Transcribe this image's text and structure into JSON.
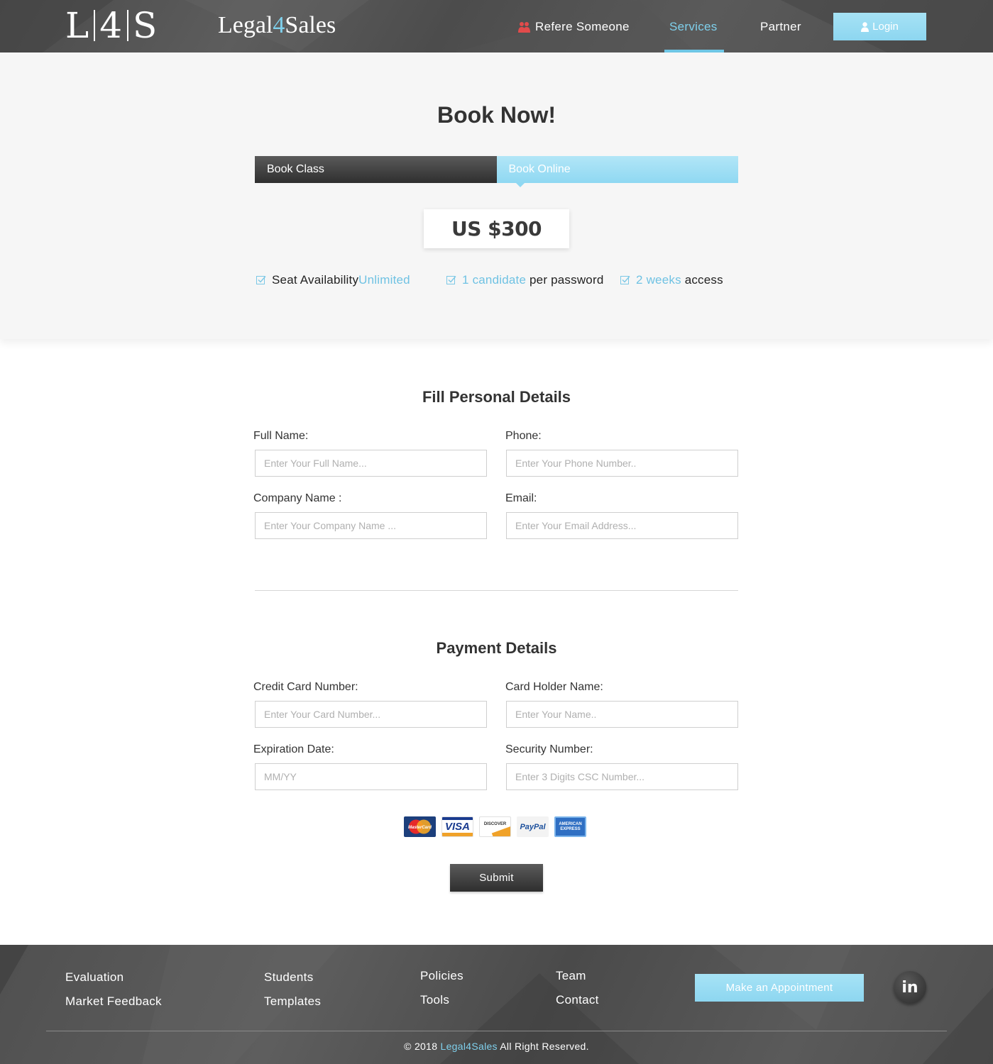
{
  "header": {
    "logo_mark": [
      "L",
      "4",
      "S"
    ],
    "brand_name_pre": "Legal",
    "brand_name_num": "4",
    "brand_name_post": "Sales",
    "nav": {
      "refer": "Refere Someone",
      "services": "Services",
      "partner": "Partner"
    },
    "login_label": "Login",
    "active_color": "#7fd0ec"
  },
  "book": {
    "title": "Book Now!",
    "tabs": [
      {
        "label": "Book Class",
        "active": false
      },
      {
        "label": "Book Online",
        "active": true
      }
    ],
    "price": "US $300",
    "features": [
      {
        "pre": "Seat Availability ",
        "highlight": "Unlimited",
        "post": ""
      },
      {
        "pre": "",
        "highlight": "1 candidate",
        "post": " per password"
      },
      {
        "pre": "",
        "highlight": "2 weeks",
        "post": " access"
      }
    ]
  },
  "personal": {
    "title": "Fill Personal Details",
    "full_name": {
      "label": "Full Name:",
      "placeholder": "Enter Your Full Name..."
    },
    "phone": {
      "label": "Phone:",
      "placeholder": "Enter Your Phone Number.."
    },
    "company": {
      "label": "Company Name :",
      "placeholder": "Enter Your Company Name ..."
    },
    "email": {
      "label": "Email:",
      "placeholder": "Enter Your Email Address..."
    }
  },
  "payment": {
    "title": "Payment Details",
    "card_number": {
      "label": "Credit Card Number:",
      "placeholder": "Enter Your Card Number..."
    },
    "holder": {
      "label": "Card Holder Name:",
      "placeholder": "Enter Your Name.."
    },
    "expiry": {
      "label": "Expiration Date:",
      "placeholder": "MM/YY"
    },
    "security": {
      "label": "Security Number:",
      "placeholder": "Enter 3 Digits CSC Number..."
    },
    "cards": [
      "MasterCard",
      "VISA",
      "DISCOVER",
      "PayPal",
      "AMERICAN EXPRESS"
    ],
    "submit_label": "Submit"
  },
  "footer": {
    "links": {
      "evaluation": "Evaluation",
      "market_feedback": "Market Feedback",
      "students": "Students",
      "templates": "Templates",
      "policies": "Policies",
      "tools": "Tools",
      "team": "Team",
      "contact": "Contact"
    },
    "appointment_label": "Make an Appointment",
    "social_icon": "linkedin-icon",
    "social_text": "in",
    "copyright_pre": "© 2018 ",
    "copyright_brand": "Legal4Sales",
    "copyright_post": " All Right Reserved."
  }
}
